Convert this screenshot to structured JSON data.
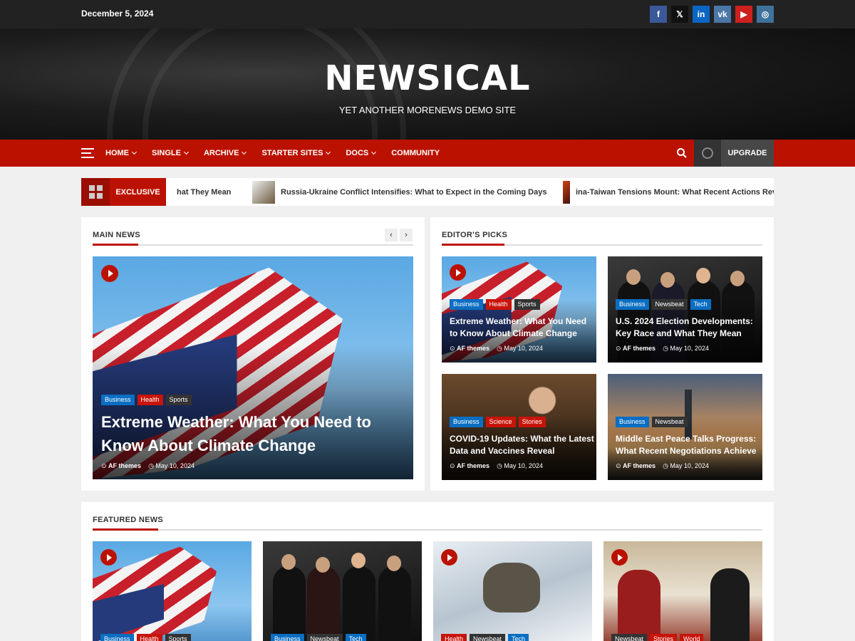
{
  "topbar": {
    "date": "December 5, 2024",
    "social": [
      {
        "icon": "facebook-icon",
        "glyph": "f",
        "color": "#3b5998"
      },
      {
        "icon": "x-icon",
        "glyph": "𝕏",
        "color": "#111111"
      },
      {
        "icon": "linkedin-icon",
        "glyph": "in",
        "color": "#0a66c2"
      },
      {
        "icon": "vk-icon",
        "glyph": "vk",
        "color": "#4a76a8"
      },
      {
        "icon": "youtube-icon",
        "glyph": "▶",
        "color": "#cd201f"
      },
      {
        "icon": "instagram-icon",
        "glyph": "◎",
        "color": "#3f729b"
      }
    ]
  },
  "header": {
    "title": "NEWSICAL",
    "tagline": "YET ANOTHER MORENEWS DEMO SITE"
  },
  "nav": {
    "items": [
      "HOME",
      "SINGLE",
      "ARCHIVE",
      "STARTER SITES",
      "DOCS",
      "COMMUNITY"
    ],
    "upgrade": "UPGRADE"
  },
  "ticker": {
    "label": "EXCLUSIVE",
    "items": [
      "hat They Mean",
      "Russia-Ukraine Conflict Intensifies: What to Expect in the Coming Days",
      "ina-Taiwan Tensions Mount: What Recent Actions Rev"
    ]
  },
  "main_news": {
    "heading": "MAIN NEWS",
    "prev": "‹",
    "next": "›",
    "article": {
      "cats": [
        "Business",
        "Health",
        "Sports"
      ],
      "title": "Extreme Weather: What You Need to Know About Climate Change",
      "author": "AF themes",
      "date": "May 10, 2024"
    }
  },
  "editors_picks": {
    "heading": "EDITOR'S PICKS",
    "items": [
      {
        "cats": [
          "Business",
          "Health",
          "Sports"
        ],
        "title": "Extreme Weather: What You Need to Know About Climate Change",
        "author": "AF themes",
        "date": "May 10, 2024"
      },
      {
        "cats": [
          "Business",
          "Newsbeat",
          "Tech"
        ],
        "title": "U.S. 2024 Election Developments: Key Race and What They Mean",
        "author": "AF themes",
        "date": "May 10, 2024"
      },
      {
        "cats": [
          "Business",
          "Science",
          "Stories"
        ],
        "title": "COVID-19 Updates: What the Latest Data and Vaccines Reveal",
        "author": "AF themes",
        "date": "May 10, 2024"
      },
      {
        "cats": [
          "Business",
          "Newsbeat"
        ],
        "title": "Middle East Peace Talks Progress: What Recent Negotiations Achieve",
        "author": "AF themes",
        "date": "May 10, 2024"
      }
    ]
  },
  "featured": {
    "heading": "FEATURED NEWS",
    "items": [
      {
        "cats": [
          "Business",
          "Health",
          "Sports"
        ]
      },
      {
        "cats": [
          "Business",
          "Newsbeat",
          "Tech"
        ]
      },
      {
        "cats": [
          "Health",
          "Newsbeat",
          "Tech"
        ]
      },
      {
        "cats": [
          "Newsbeat",
          "Stories",
          "World"
        ]
      }
    ]
  },
  "meta_icons": {
    "author": "author-icon",
    "date": "clock-icon"
  },
  "colors": {
    "brand": "#bb1100",
    "topbar": "#222222",
    "category_blue": "#0a6ec2",
    "category_red": "#c8140a",
    "category_dark": "#333333"
  }
}
